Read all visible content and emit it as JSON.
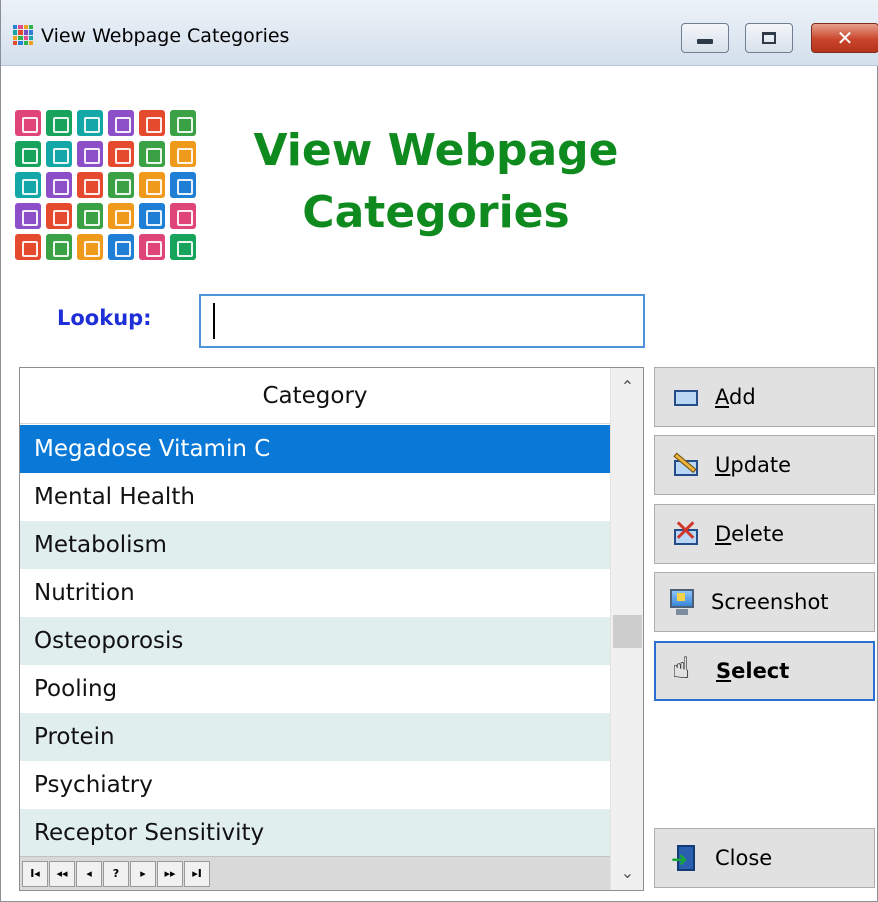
{
  "window": {
    "title": "View Webpage Categories",
    "close_glyph": "✕"
  },
  "heading": {
    "line1": "View Webpage",
    "line2": "Categories"
  },
  "lookup": {
    "label": "Lookup:",
    "value": ""
  },
  "grid": {
    "column_header": "Category",
    "rows": [
      "Megadose Vitamin C",
      "Mental Health",
      "Metabolism",
      "Nutrition",
      "Osteoporosis",
      "Pooling",
      "Protein",
      "Psychiatry",
      "Receptor Sensitivity"
    ],
    "selected_row": "Megadose Vitamin C",
    "navigator": [
      "I◂",
      "◂◂",
      "◂",
      "?",
      "▸",
      "▸▸",
      "▸I"
    ]
  },
  "buttons": {
    "add": {
      "mnemonic": "A",
      "rest": "dd"
    },
    "update": {
      "mnemonic": "U",
      "rest": "pdate"
    },
    "delete": {
      "mnemonic": "D",
      "rest": "elete"
    },
    "screenshot": {
      "label": "Screenshot"
    },
    "select": {
      "mnemonic": "S",
      "rest": "elect"
    },
    "close": {
      "label": "Close"
    }
  },
  "colors": {
    "heading": "#0f8a1f",
    "lookup_label": "#1f2fd8",
    "selected_row": "#0a78d7",
    "alt_row": "#e1eeee"
  },
  "icons": [
    "app-icon",
    "category-logo-icon",
    "add-icon",
    "update-icon",
    "delete-icon",
    "screenshot-icon",
    "select-hand-icon",
    "close-door-icon",
    "minimize-icon",
    "maximize-icon",
    "close-icon"
  ]
}
